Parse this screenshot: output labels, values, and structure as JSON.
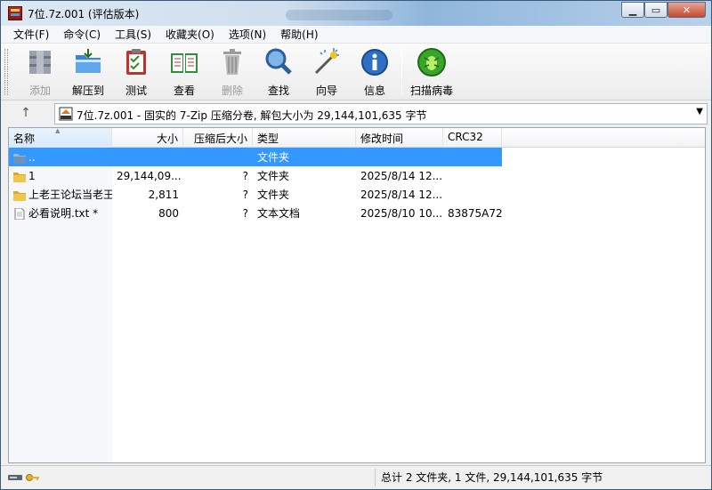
{
  "window": {
    "title": "7位.7z.001 (评估版本)"
  },
  "menu": [
    "文件(F)",
    "命令(C)",
    "工具(S)",
    "收藏夹(O)",
    "选项(N)",
    "帮助(H)"
  ],
  "toolbar": {
    "add": "添加",
    "extract": "解压到",
    "test": "测试",
    "view": "查看",
    "delete": "删除",
    "find": "查找",
    "wizard": "向导",
    "info": "信息",
    "scan": "扫描病毒"
  },
  "address": {
    "up": "↑",
    "path": "7位.7z.001 - 固实的 7-Zip 压缩分卷, 解包大小为 29,144,101,635 字节",
    "drop": "▼"
  },
  "columns": {
    "name": "名称",
    "size": "大小",
    "packed": "压缩后大小",
    "type": "类型",
    "modified": "修改时间",
    "crc": "CRC32"
  },
  "rows": [
    {
      "name": "..",
      "size": "",
      "packed": "",
      "type": "文件夹",
      "modified": "",
      "crc": ""
    },
    {
      "name": "1",
      "size": "29,144,09...",
      "packed": "?",
      "type": "文件夹",
      "modified": "2025/8/14 12...",
      "crc": ""
    },
    {
      "name": "上老王论坛当老王",
      "size": "2,811",
      "packed": "?",
      "type": "文件夹",
      "modified": "2025/8/14 12...",
      "crc": ""
    },
    {
      "name": "必看说明.txt *",
      "size": "800",
      "packed": "?",
      "type": "文本文档",
      "modified": "2025/8/10 10...",
      "crc": "83875A72"
    }
  ],
  "status": {
    "summary": "总计 2 文件夹, 1 文件, 29,144,101,635 字节"
  }
}
